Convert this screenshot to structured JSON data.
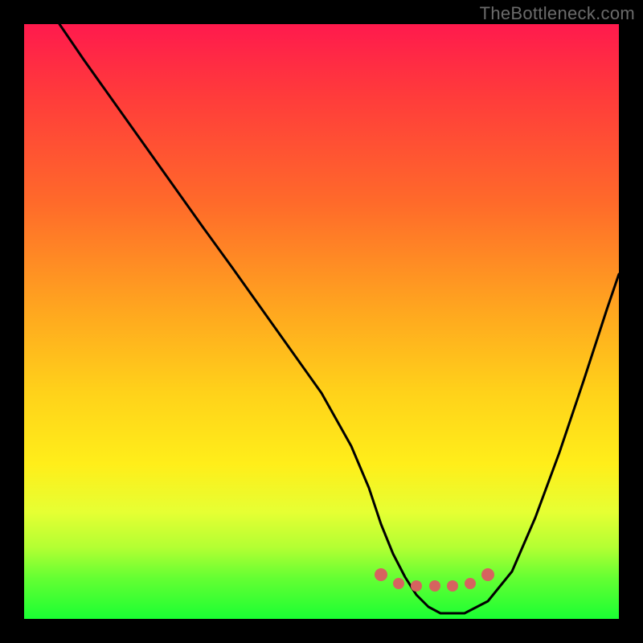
{
  "watermark": {
    "text": "TheBottleneck.com"
  },
  "chart_data": {
    "type": "line",
    "title": "",
    "xlabel": "",
    "ylabel": "",
    "xlim": [
      0,
      100
    ],
    "ylim": [
      0,
      100
    ],
    "grid": false,
    "legend": false,
    "series": [
      {
        "name": "bottleneck-curve",
        "color": "#000000",
        "x": [
          6,
          10,
          15,
          20,
          25,
          30,
          35,
          40,
          45,
          50,
          55,
          58,
          60,
          62,
          64,
          66,
          68,
          70,
          72,
          74,
          78,
          82,
          86,
          90,
          94,
          98,
          100
        ],
        "y": [
          100,
          94,
          87,
          80,
          73,
          66,
          59,
          52,
          45,
          38,
          29,
          22,
          16,
          11,
          7,
          4,
          2,
          1,
          1,
          1,
          3,
          8,
          17,
          28,
          40,
          52,
          58
        ]
      }
    ],
    "markers": {
      "name": "sweet-spot-dots",
      "color": "#d6635f",
      "radius": 7,
      "points": [
        {
          "x": 60,
          "y": 7.5
        },
        {
          "x": 63,
          "y": 6.0
        },
        {
          "x": 66,
          "y": 5.5
        },
        {
          "x": 69,
          "y": 5.5
        },
        {
          "x": 72,
          "y": 5.5
        },
        {
          "x": 75,
          "y": 6.0
        },
        {
          "x": 78,
          "y": 7.5
        }
      ]
    },
    "gradient_stops": [
      {
        "pct": 0,
        "color": "#ff1a4d"
      },
      {
        "pct": 12,
        "color": "#ff3b3b"
      },
      {
        "pct": 30,
        "color": "#ff6a2a"
      },
      {
        "pct": 48,
        "color": "#ffa61f"
      },
      {
        "pct": 62,
        "color": "#ffd21a"
      },
      {
        "pct": 74,
        "color": "#ffee1a"
      },
      {
        "pct": 82,
        "color": "#e6ff33"
      },
      {
        "pct": 88,
        "color": "#b3ff33"
      },
      {
        "pct": 93,
        "color": "#66ff33"
      },
      {
        "pct": 100,
        "color": "#1aff33"
      }
    ]
  }
}
